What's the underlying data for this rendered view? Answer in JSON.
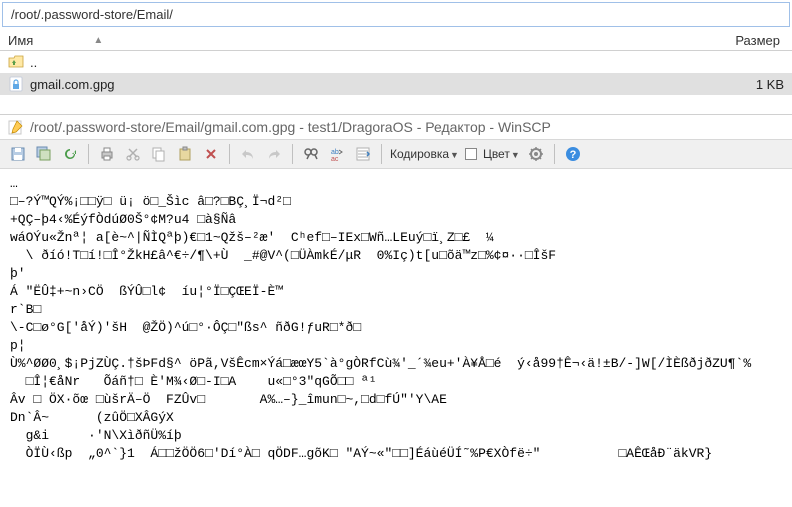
{
  "pathBar": "/root/.password-store/Email/",
  "fileList": {
    "headers": {
      "name": "Имя",
      "size": "Размер"
    },
    "rows": [
      {
        "name": "..",
        "size": ""
      },
      {
        "name": "gmail.com.gpg",
        "size": "1 KB"
      }
    ]
  },
  "editor": {
    "title": "/root/.password-store/Email/gmail.com.gpg - test1/DragoraOS - Редактор - WinSCP",
    "encodingLabel": "Кодировка",
    "colorLabel": "Цвет",
    "content": "…\n□–?Ý™QÝ%¡□□ÿ□ ü¡ ö□_Šìc â□?□BÇ¸Ï¬d²□\n+QÇ–þ4‹%ÉýfÒdúØ0Š°¢M?u4 □à§Ñâ\nwáOÝu«Žnª¦ a[è~^|ÑÌQªþ)€□1~Qžš–²æ'  Cʰef□–IEx□Wñ…LEuý□ï¸Z□£  ¼\n  \\ ðíó!T□í!□Î°ŽkH£â^€÷/¶\\+Ù  _#@V^(□ÜÀmkÉ/μR  0%Iç)t[u□õä™z□%¢¤··□ÎšF\nþ'\nÁ \"ËÛ‡+~n›CÖ  ßÝÛ□l¢  íu¦°Ï□ÇŒEÏ-È™\nr`B□\n\\-C□ø°G['åÝ)'šH  @ŽÖ)^ú□°·ÔÇ□\"ßs^ ñðG!ƒuR□*ð□\np¦\nÙ%^ØØ0¸$¡PjZÙÇ.†šÞFd§^ öPã,VšÊcm×Ýá□æœY5`à°gÒRfCù¾'_´¾eu+'À¥Å□é  ý‹å99†Ê¬‹ä!±B/-]W[/ÌÈßðjðZU¶`%\n  □Î¦€åNr   Õáñ†□ È'M¾‹Ø□-I□A    u«□°3\"qGÕ□□ ª¹\nÂv □ ÖX·õœ □ùšrÄ–Ö  FZÛv□       A%…–}_îmun□~,□d□fÚ\"'Y\\AE\nDn`Â~      (zûÖ□XÂGýX\n  g&i     ·'N\\XìðñÜ%íþ\n  ÒÏÙ‹ßp  „0^`}1  Á□□žÖÖ6□'Dí°À□ qÖDF…gõK□ \"AÝ~«\"□□]ÉáùéÜÍ˜%P€XÒfë÷\"          □AÊŒåĐ¨äkVR}"
  }
}
